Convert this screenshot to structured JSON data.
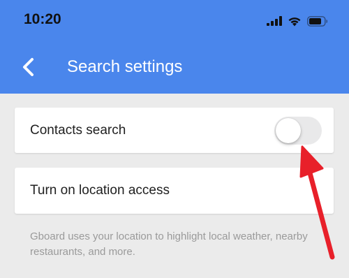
{
  "status_bar": {
    "time": "10:20",
    "icons": [
      "signal-icon",
      "wifi-icon",
      "battery-icon"
    ]
  },
  "header": {
    "back_icon": "chevron-left-icon",
    "title": "Search settings"
  },
  "settings": {
    "contacts_search": {
      "label": "Contacts search",
      "toggle_on": false
    },
    "location_access": {
      "label": "Turn on location access"
    },
    "helper_text": "Gboard uses your location to highlight local weather, nearby restaurants, and more."
  },
  "annotation": {
    "icon": "red-arrow-icon",
    "color": "#e8202a"
  },
  "colors": {
    "header_bg": "#4a86ec",
    "page_bg": "#ebebeb"
  }
}
